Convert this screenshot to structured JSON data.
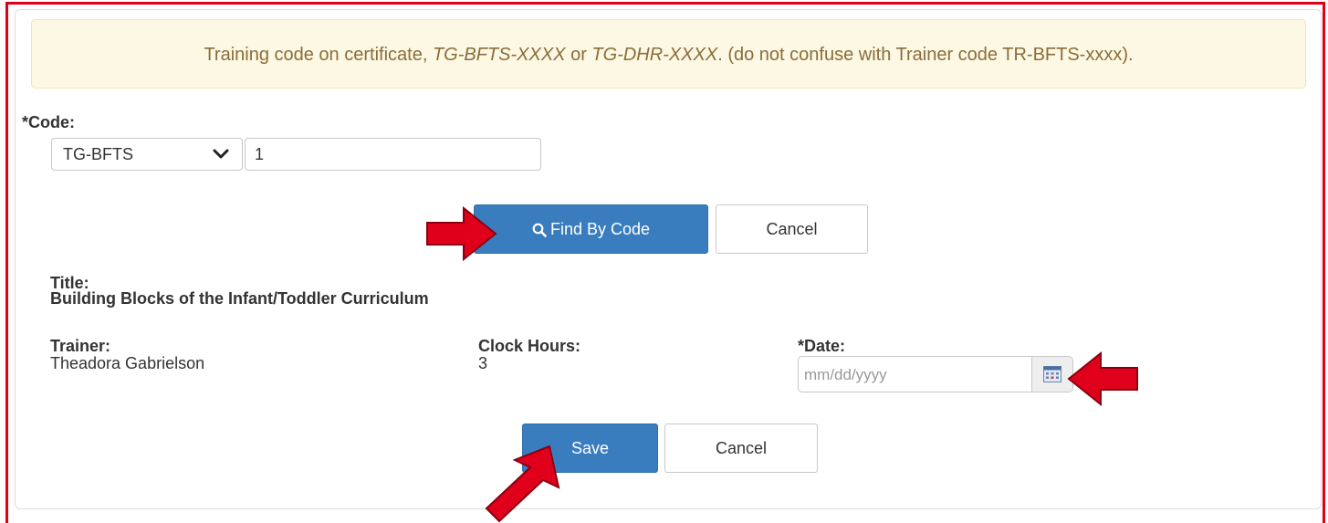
{
  "alert": {
    "prefix": "Training code on certificate, ",
    "code1": "TG-BFTS-XXXX",
    "middle": " or ",
    "code2": "TG-DHR-XXXX",
    "suffix": ". (do not confuse with Trainer code TR-BFTS-xxxx)."
  },
  "code": {
    "label": "*Code:",
    "prefix_selected": "TG-BFTS",
    "value": "1"
  },
  "find_button": {
    "label": "Find By Code",
    "icon": "search-icon"
  },
  "cancel_button_1": {
    "label": "Cancel"
  },
  "training": {
    "title_label": "Title:",
    "title_value": "Building Blocks of the Infant/Toddler Curriculum",
    "trainer_label": "Trainer:",
    "trainer_value": "Theadora Gabrielson",
    "hours_label": "Clock Hours:",
    "hours_value": "3"
  },
  "date": {
    "label": "*Date:",
    "placeholder": "mm/dd/yyyy",
    "icon": "calendar-icon"
  },
  "save_button": {
    "label": "Save"
  },
  "cancel_button_2": {
    "label": "Cancel"
  },
  "colors": {
    "frame": "#e0001b",
    "primary": "#3a7dbf",
    "alert_bg": "#fcf8e3",
    "alert_text": "#8a6d3b",
    "arrow_fill": "#e0001b"
  }
}
